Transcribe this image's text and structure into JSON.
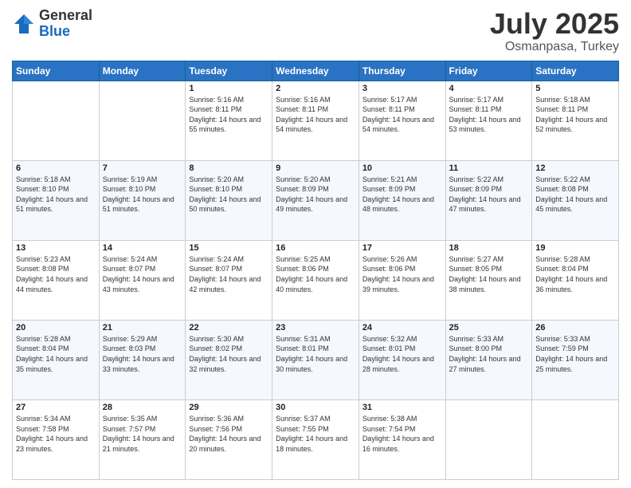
{
  "logo": {
    "general": "General",
    "blue": "Blue"
  },
  "title": {
    "month": "July 2025",
    "location": "Osmanpasa, Turkey"
  },
  "weekdays": [
    "Sunday",
    "Monday",
    "Tuesday",
    "Wednesday",
    "Thursday",
    "Friday",
    "Saturday"
  ],
  "weeks": [
    [
      {
        "date": "",
        "sunrise": "",
        "sunset": "",
        "daylight": ""
      },
      {
        "date": "",
        "sunrise": "",
        "sunset": "",
        "daylight": ""
      },
      {
        "date": "1",
        "sunrise": "Sunrise: 5:16 AM",
        "sunset": "Sunset: 8:11 PM",
        "daylight": "Daylight: 14 hours and 55 minutes."
      },
      {
        "date": "2",
        "sunrise": "Sunrise: 5:16 AM",
        "sunset": "Sunset: 8:11 PM",
        "daylight": "Daylight: 14 hours and 54 minutes."
      },
      {
        "date": "3",
        "sunrise": "Sunrise: 5:17 AM",
        "sunset": "Sunset: 8:11 PM",
        "daylight": "Daylight: 14 hours and 54 minutes."
      },
      {
        "date": "4",
        "sunrise": "Sunrise: 5:17 AM",
        "sunset": "Sunset: 8:11 PM",
        "daylight": "Daylight: 14 hours and 53 minutes."
      },
      {
        "date": "5",
        "sunrise": "Sunrise: 5:18 AM",
        "sunset": "Sunset: 8:11 PM",
        "daylight": "Daylight: 14 hours and 52 minutes."
      }
    ],
    [
      {
        "date": "6",
        "sunrise": "Sunrise: 5:18 AM",
        "sunset": "Sunset: 8:10 PM",
        "daylight": "Daylight: 14 hours and 51 minutes."
      },
      {
        "date": "7",
        "sunrise": "Sunrise: 5:19 AM",
        "sunset": "Sunset: 8:10 PM",
        "daylight": "Daylight: 14 hours and 51 minutes."
      },
      {
        "date": "8",
        "sunrise": "Sunrise: 5:20 AM",
        "sunset": "Sunset: 8:10 PM",
        "daylight": "Daylight: 14 hours and 50 minutes."
      },
      {
        "date": "9",
        "sunrise": "Sunrise: 5:20 AM",
        "sunset": "Sunset: 8:09 PM",
        "daylight": "Daylight: 14 hours and 49 minutes."
      },
      {
        "date": "10",
        "sunrise": "Sunrise: 5:21 AM",
        "sunset": "Sunset: 8:09 PM",
        "daylight": "Daylight: 14 hours and 48 minutes."
      },
      {
        "date": "11",
        "sunrise": "Sunrise: 5:22 AM",
        "sunset": "Sunset: 8:09 PM",
        "daylight": "Daylight: 14 hours and 47 minutes."
      },
      {
        "date": "12",
        "sunrise": "Sunrise: 5:22 AM",
        "sunset": "Sunset: 8:08 PM",
        "daylight": "Daylight: 14 hours and 45 minutes."
      }
    ],
    [
      {
        "date": "13",
        "sunrise": "Sunrise: 5:23 AM",
        "sunset": "Sunset: 8:08 PM",
        "daylight": "Daylight: 14 hours and 44 minutes."
      },
      {
        "date": "14",
        "sunrise": "Sunrise: 5:24 AM",
        "sunset": "Sunset: 8:07 PM",
        "daylight": "Daylight: 14 hours and 43 minutes."
      },
      {
        "date": "15",
        "sunrise": "Sunrise: 5:24 AM",
        "sunset": "Sunset: 8:07 PM",
        "daylight": "Daylight: 14 hours and 42 minutes."
      },
      {
        "date": "16",
        "sunrise": "Sunrise: 5:25 AM",
        "sunset": "Sunset: 8:06 PM",
        "daylight": "Daylight: 14 hours and 40 minutes."
      },
      {
        "date": "17",
        "sunrise": "Sunrise: 5:26 AM",
        "sunset": "Sunset: 8:06 PM",
        "daylight": "Daylight: 14 hours and 39 minutes."
      },
      {
        "date": "18",
        "sunrise": "Sunrise: 5:27 AM",
        "sunset": "Sunset: 8:05 PM",
        "daylight": "Daylight: 14 hours and 38 minutes."
      },
      {
        "date": "19",
        "sunrise": "Sunrise: 5:28 AM",
        "sunset": "Sunset: 8:04 PM",
        "daylight": "Daylight: 14 hours and 36 minutes."
      }
    ],
    [
      {
        "date": "20",
        "sunrise": "Sunrise: 5:28 AM",
        "sunset": "Sunset: 8:04 PM",
        "daylight": "Daylight: 14 hours and 35 minutes."
      },
      {
        "date": "21",
        "sunrise": "Sunrise: 5:29 AM",
        "sunset": "Sunset: 8:03 PM",
        "daylight": "Daylight: 14 hours and 33 minutes."
      },
      {
        "date": "22",
        "sunrise": "Sunrise: 5:30 AM",
        "sunset": "Sunset: 8:02 PM",
        "daylight": "Daylight: 14 hours and 32 minutes."
      },
      {
        "date": "23",
        "sunrise": "Sunrise: 5:31 AM",
        "sunset": "Sunset: 8:01 PM",
        "daylight": "Daylight: 14 hours and 30 minutes."
      },
      {
        "date": "24",
        "sunrise": "Sunrise: 5:32 AM",
        "sunset": "Sunset: 8:01 PM",
        "daylight": "Daylight: 14 hours and 28 minutes."
      },
      {
        "date": "25",
        "sunrise": "Sunrise: 5:33 AM",
        "sunset": "Sunset: 8:00 PM",
        "daylight": "Daylight: 14 hours and 27 minutes."
      },
      {
        "date": "26",
        "sunrise": "Sunrise: 5:33 AM",
        "sunset": "Sunset: 7:59 PM",
        "daylight": "Daylight: 14 hours and 25 minutes."
      }
    ],
    [
      {
        "date": "27",
        "sunrise": "Sunrise: 5:34 AM",
        "sunset": "Sunset: 7:58 PM",
        "daylight": "Daylight: 14 hours and 23 minutes."
      },
      {
        "date": "28",
        "sunrise": "Sunrise: 5:35 AM",
        "sunset": "Sunset: 7:57 PM",
        "daylight": "Daylight: 14 hours and 21 minutes."
      },
      {
        "date": "29",
        "sunrise": "Sunrise: 5:36 AM",
        "sunset": "Sunset: 7:56 PM",
        "daylight": "Daylight: 14 hours and 20 minutes."
      },
      {
        "date": "30",
        "sunrise": "Sunrise: 5:37 AM",
        "sunset": "Sunset: 7:55 PM",
        "daylight": "Daylight: 14 hours and 18 minutes."
      },
      {
        "date": "31",
        "sunrise": "Sunrise: 5:38 AM",
        "sunset": "Sunset: 7:54 PM",
        "daylight": "Daylight: 14 hours and 16 minutes."
      },
      {
        "date": "",
        "sunrise": "",
        "sunset": "",
        "daylight": ""
      },
      {
        "date": "",
        "sunrise": "",
        "sunset": "",
        "daylight": ""
      }
    ]
  ]
}
